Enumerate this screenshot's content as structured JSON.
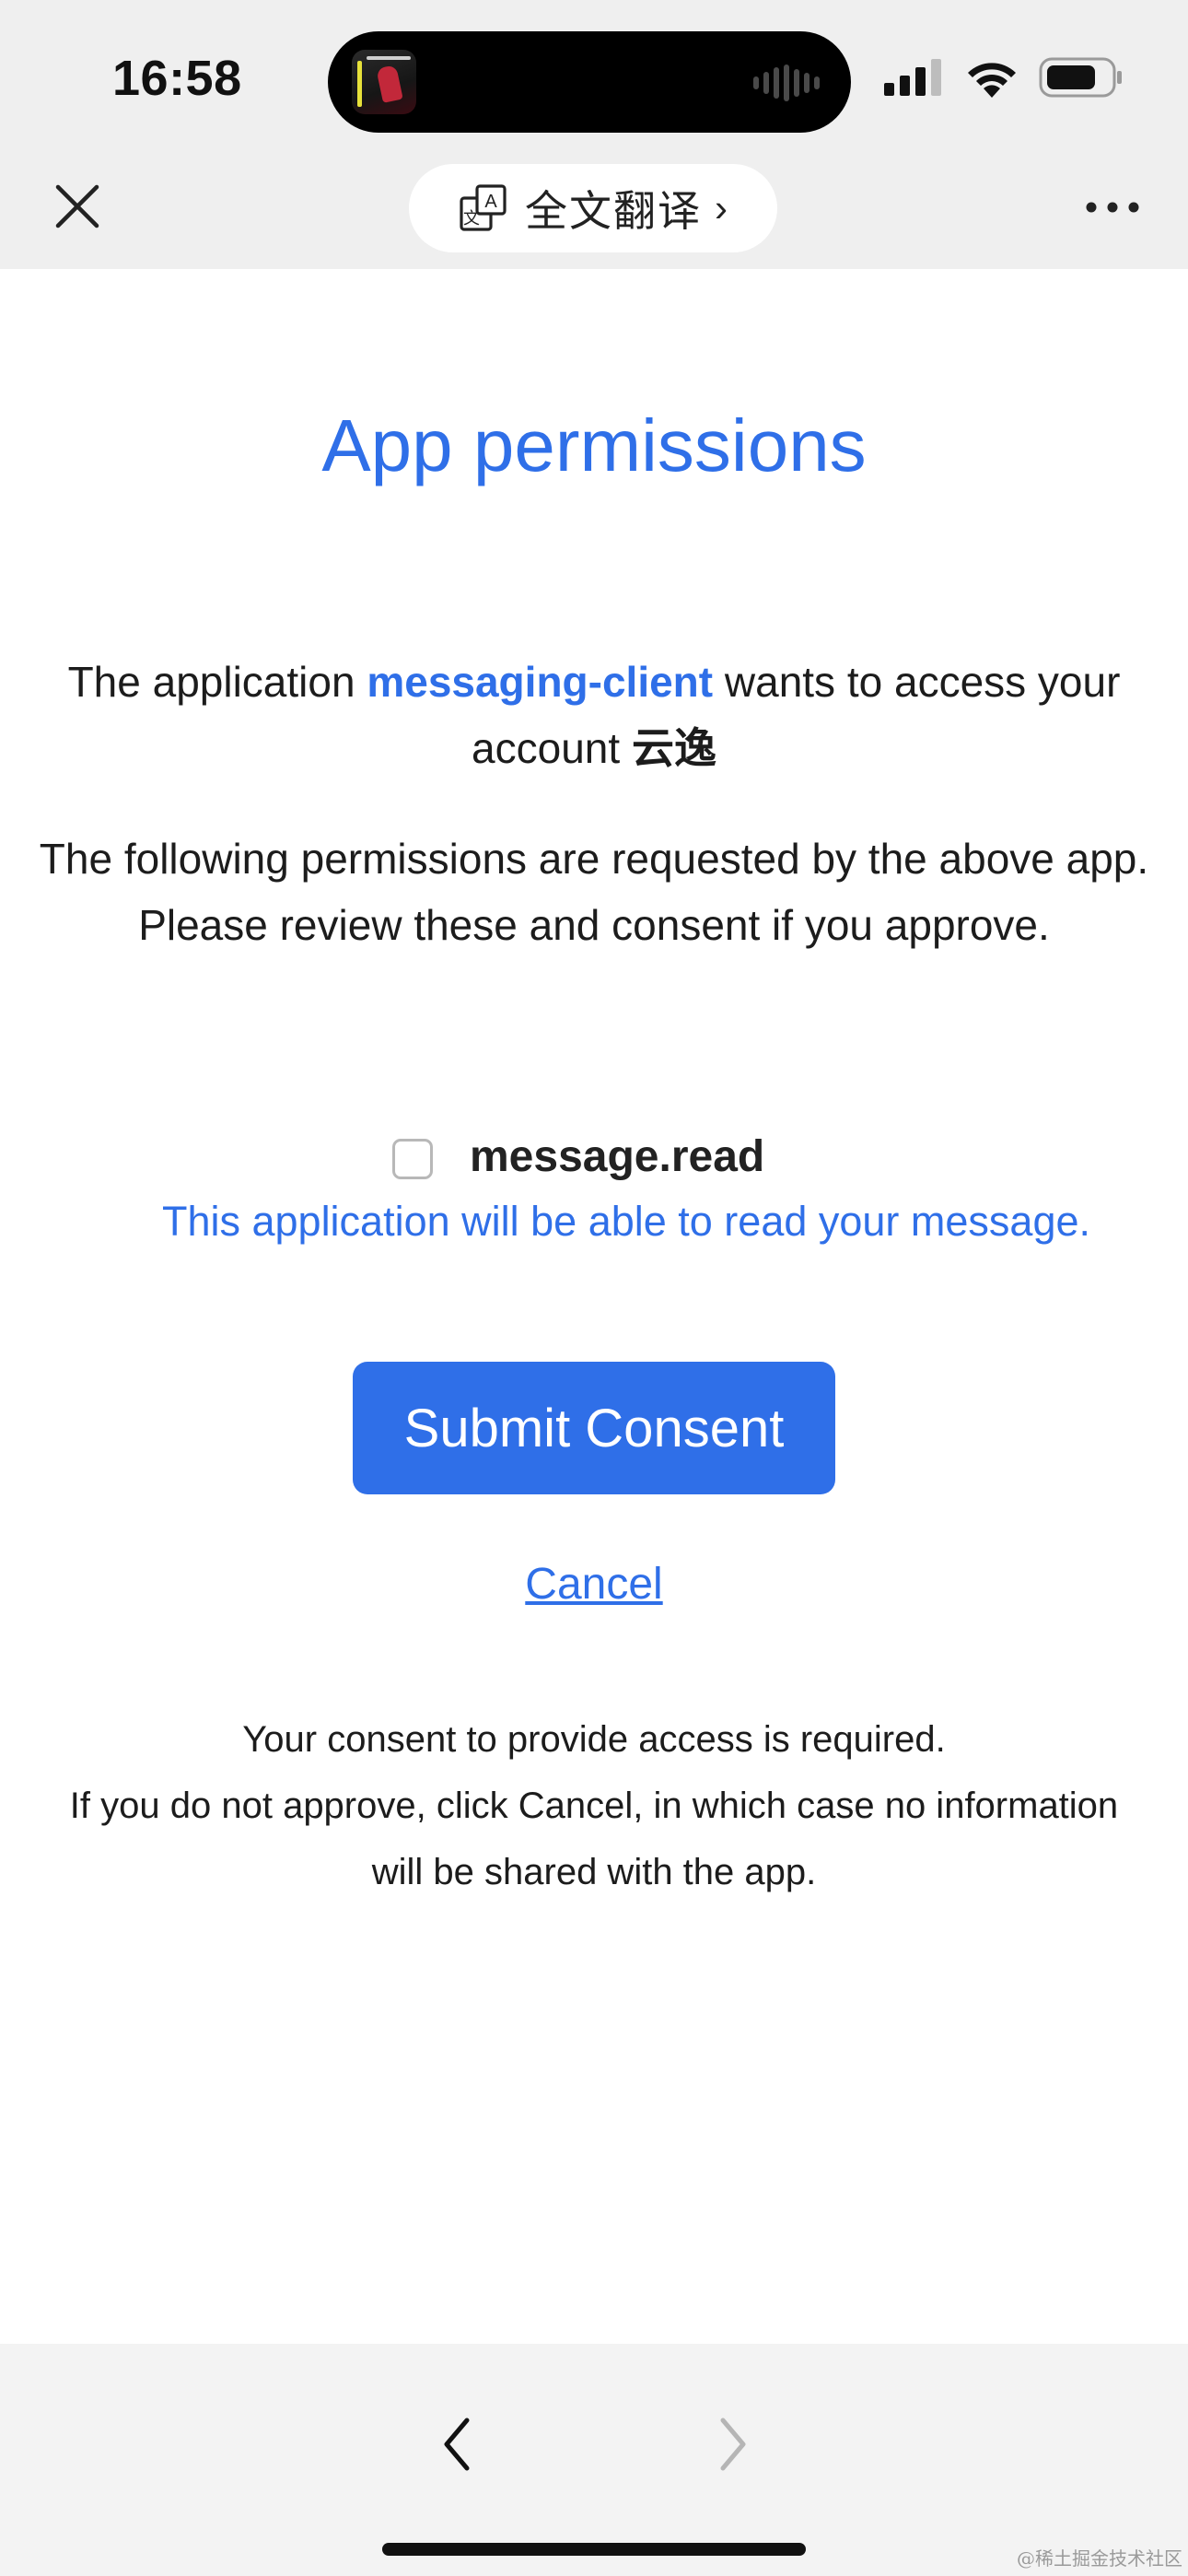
{
  "status_bar": {
    "time": "16:58",
    "signal_icon": "cellular-signal-icon",
    "wifi_icon": "wifi-icon",
    "battery_icon": "battery-icon"
  },
  "browser_bar": {
    "close_icon": "close-icon",
    "translate_icon": "translate-icon",
    "translate_label": "全文翻译",
    "translate_chevron": "›",
    "more_icon": "more-icon"
  },
  "page": {
    "title": "App permissions",
    "intro_prefix": "The application ",
    "app_name": "messaging-client",
    "intro_middle": " wants to access your account ",
    "account_name": "云逸",
    "request_line1": "The following permissions are requested by the above app.",
    "request_line2": "Please review these and consent if you approve.",
    "permission": {
      "name": "message.read",
      "description": "This application will be able to read your message.",
      "checked": false
    },
    "submit_label": "Submit Consent",
    "cancel_label": "Cancel",
    "note_line1": "Your consent to provide access is required.",
    "note_line2": "If you do not approve, click Cancel, in which case no information will be shared with the app."
  },
  "bottom_nav": {
    "back_icon": "chevron-left-icon",
    "forward_icon": "chevron-right-icon"
  },
  "watermark": "@稀土掘金技术社区",
  "colors": {
    "accent": "#2f6fe8",
    "chrome_bg": "#efefef",
    "text": "#1c1c1c"
  }
}
